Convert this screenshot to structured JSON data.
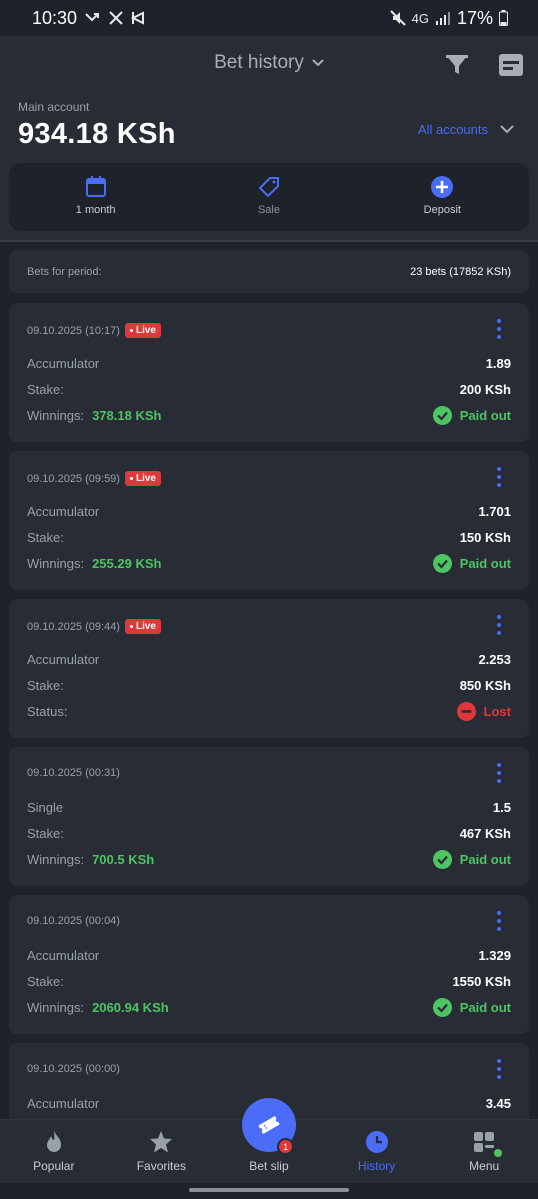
{
  "status_bar": {
    "time": "10:30",
    "network": "4G",
    "battery": "17%"
  },
  "header": {
    "title": "Bet history",
    "account_label": "Main account",
    "balance": "934.18 KSh",
    "all_accounts": "All accounts"
  },
  "quick_actions": [
    {
      "label": "1 month",
      "icon": "calendar-icon"
    },
    {
      "label": "Sale",
      "icon": "tag-icon"
    },
    {
      "label": "Deposit",
      "icon": "plus-circle-icon"
    }
  ],
  "period": {
    "label": "Bets for period:",
    "value": "23 bets (17852 KSh)"
  },
  "live_label": "Live",
  "bets": [
    {
      "date": "09.10.2025 (10:17)",
      "live": true,
      "type": "Accumulator",
      "coef": "1.89",
      "stake_label": "Stake:",
      "stake": "200 KSh",
      "result_label": "Winnings:",
      "winnings": "378.18 KSh",
      "status": "Paid out"
    },
    {
      "date": "09.10.2025 (09:59)",
      "live": true,
      "type": "Accumulator",
      "coef": "1.701",
      "stake_label": "Stake:",
      "stake": "150 KSh",
      "result_label": "Winnings:",
      "winnings": "255.29 KSh",
      "status": "Paid out"
    },
    {
      "date": "09.10.2025 (09:44)",
      "live": true,
      "type": "Accumulator",
      "coef": "2.253",
      "stake_label": "Stake:",
      "stake": "850 KSh",
      "result_label": "Status:",
      "winnings": "",
      "status": "Lost"
    },
    {
      "date": "09.10.2025 (00:31)",
      "live": false,
      "type": "Single",
      "coef": "1.5",
      "stake_label": "Stake:",
      "stake": "467 KSh",
      "result_label": "Winnings:",
      "winnings": "700.5 KSh",
      "status": "Paid out"
    },
    {
      "date": "09.10.2025 (00:04)",
      "live": false,
      "type": "Accumulator",
      "coef": "1.329",
      "stake_label": "Stake:",
      "stake": "1550 KSh",
      "result_label": "Winnings:",
      "winnings": "2060.94 KSh",
      "status": "Paid out"
    },
    {
      "date": "09.10.2025 (00:00)",
      "live": false,
      "type": "Accumulator",
      "coef": "3.45",
      "stake_label": "",
      "stake": "",
      "result_label": "",
      "winnings": "",
      "status": ""
    }
  ],
  "bottom_nav": [
    {
      "label": "Popular",
      "icon": "flame-icon"
    },
    {
      "label": "Favorites",
      "icon": "star-icon"
    },
    {
      "label": "Bet slip",
      "icon": "ticket-icon",
      "badge": "1"
    },
    {
      "label": "History",
      "icon": "clock-icon"
    },
    {
      "label": "Menu",
      "icon": "grid-icon"
    }
  ],
  "colors": {
    "accent": "#4a6cf7",
    "win": "#4cc564",
    "lost": "#e0383a",
    "card": "#272c35",
    "background": "#1e232b"
  }
}
